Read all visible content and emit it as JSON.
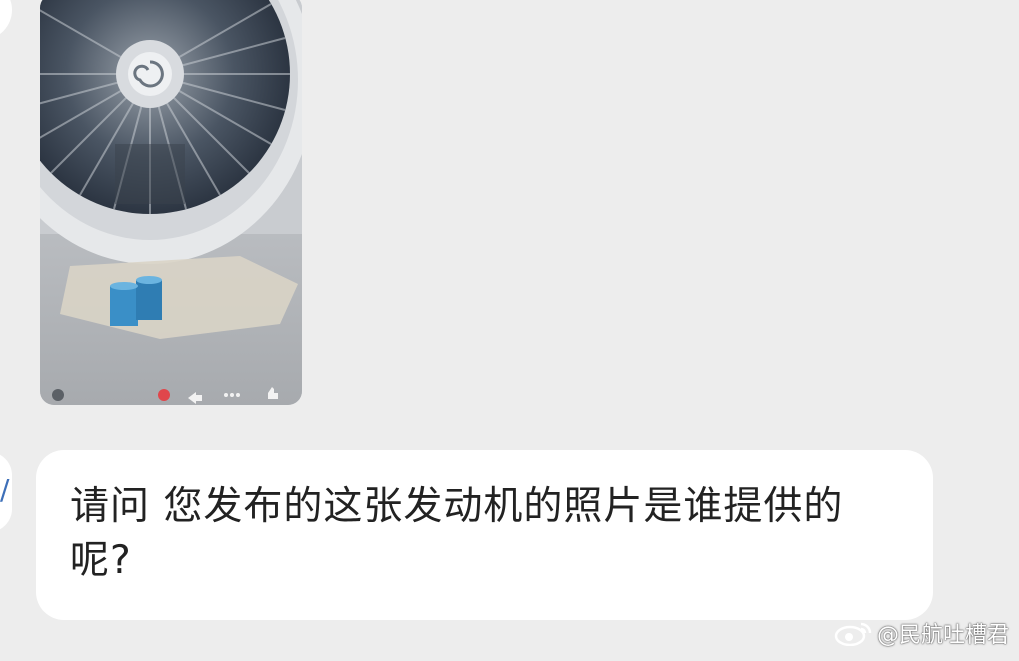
{
  "chat": {
    "incoming_photo": {
      "alt": "aircraft engine fan photo",
      "toolbar_icons": [
        "back-icon",
        "record-icon",
        "share-icon",
        "more-icon",
        "like-icon"
      ]
    },
    "incoming_text": {
      "message": "请问 您发布的这张发动机的照片是谁提供的呢?"
    }
  },
  "watermark": {
    "text": "@民航吐槽君",
    "logo": "weibo-logo"
  },
  "colors": {
    "background": "#ededed",
    "bubble": "#ffffff",
    "text": "#222222",
    "avatar_accent": "#3d6fb8"
  }
}
